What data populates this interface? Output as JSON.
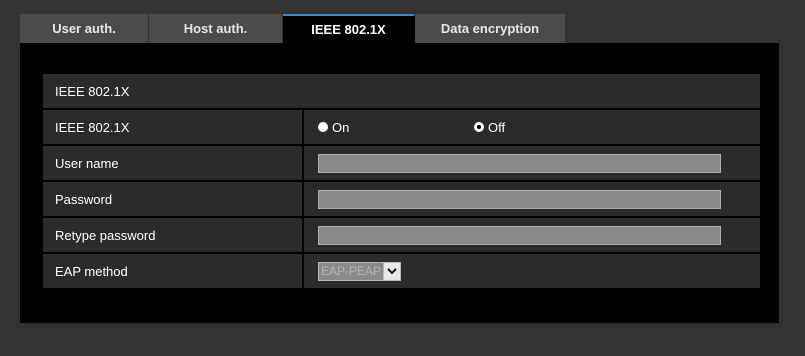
{
  "tabs": [
    {
      "label": "User auth.",
      "active": false
    },
    {
      "label": "Host auth.",
      "active": false
    },
    {
      "label": "IEEE 802.1X",
      "active": true
    },
    {
      "label": "Data encryption",
      "active": false
    }
  ],
  "section": {
    "title": "IEEE 802.1X"
  },
  "form": {
    "ieee": {
      "label": "IEEE 802.1X",
      "options": [
        "On",
        "Off"
      ],
      "selected": "Off"
    },
    "username": {
      "label": "User name",
      "value": ""
    },
    "password": {
      "label": "Password",
      "value": ""
    },
    "retype": {
      "label": "Retype password",
      "value": ""
    },
    "eap": {
      "label": "EAP method",
      "selected": "EAP-PEAP"
    }
  },
  "colors": {
    "background": "#333333",
    "panel": "#000000",
    "cell": "#2b2b2b",
    "tab": "#4b4b4b",
    "active_tab_accent": "#2e8bd7",
    "input": "#8a8a8a"
  },
  "icons": {
    "select_arrow": "chevron-down-icon"
  }
}
